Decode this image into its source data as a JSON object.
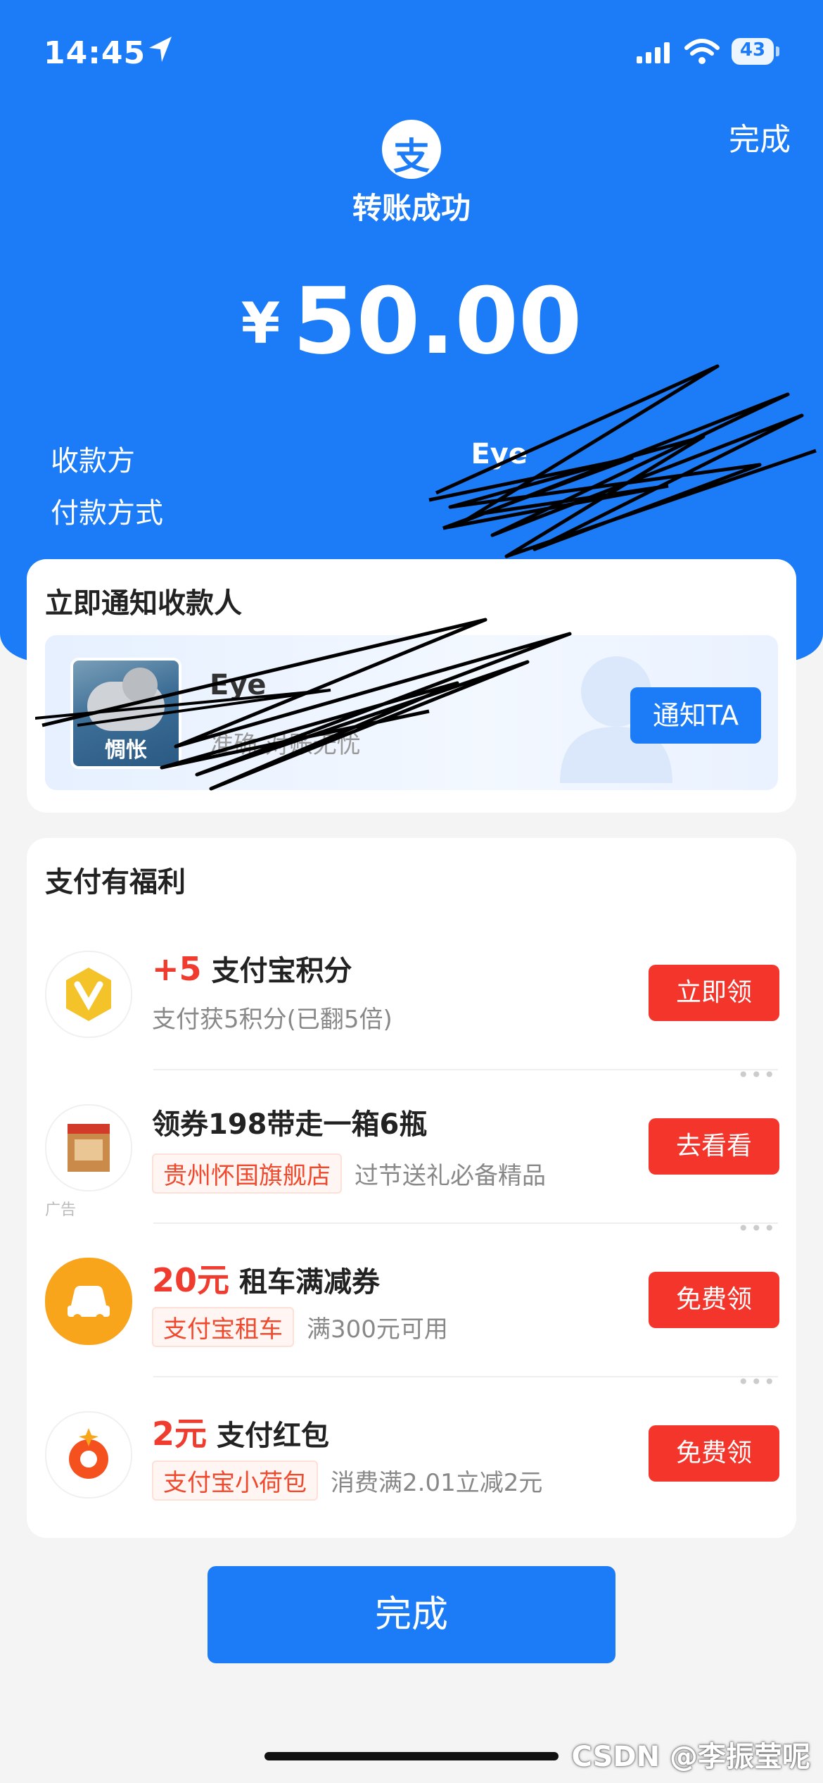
{
  "status_bar": {
    "time": "14:45",
    "battery": "43"
  },
  "header": {
    "done_label": "完成",
    "logo_char": "支",
    "title": "转账成功",
    "currency": "¥",
    "amount": "50.00",
    "payee_label": "收款方",
    "payee_value": "Eye",
    "payment_method_label": "付款方式",
    "payment_method_value": ""
  },
  "notify_card": {
    "title": "立即通知收款人",
    "avatar_caption": "惆怅",
    "name": "Eye",
    "subtitle": "准确  对账无忧",
    "button_label": "通知TA"
  },
  "benefits_card": {
    "title": "支付有福利",
    "items": [
      {
        "highlight": "+5",
        "title": "支付宝积分",
        "tag": "",
        "subtitle": "支付获5积分(已翻5倍)",
        "button": "立即领",
        "icon": "alipay-points-icon"
      },
      {
        "highlight": "",
        "title": "领券198带走一箱6瓶",
        "tag": "贵州怀国旗舰店",
        "subtitle": "过节送礼必备精品",
        "button": "去看看",
        "ad_label": "广告",
        "icon": "liquor-box-icon"
      },
      {
        "highlight": "20元",
        "title": "租车满减券",
        "tag": "支付宝租车",
        "subtitle": "满300元可用",
        "button": "免费领",
        "icon": "car-rental-icon"
      },
      {
        "highlight": "2元",
        "title": "支付红包",
        "tag": "支付宝小荷包",
        "subtitle": "消费满2.01立减2元",
        "button": "免费领",
        "icon": "red-packet-icon"
      }
    ]
  },
  "footer": {
    "done_label": "完成",
    "watermark": "CSDN @李振莹呢"
  },
  "colors": {
    "brand_blue": "#1c7bf7",
    "red": "#f4352b",
    "background": "#f4f4f4"
  }
}
